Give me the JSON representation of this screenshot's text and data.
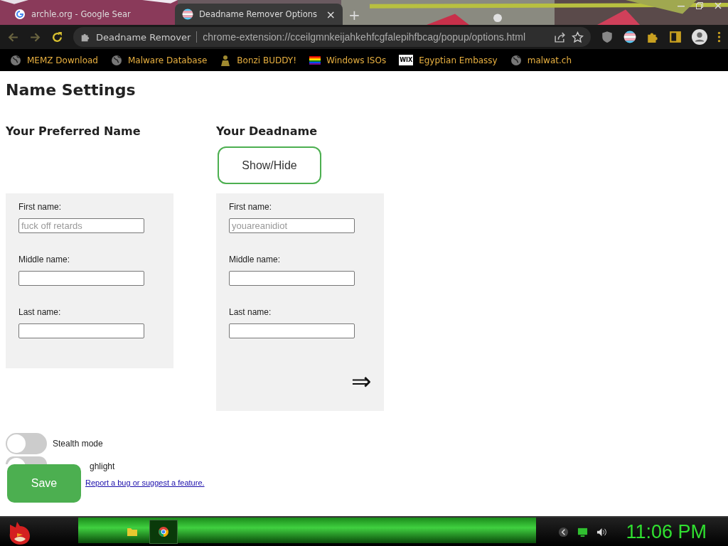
{
  "browser": {
    "tabs": [
      {
        "title": "archle.org - Google Sear",
        "selected": false,
        "kind": "google"
      },
      {
        "title": "Deadname Remover Options",
        "selected": true,
        "kind": "flag"
      }
    ],
    "tab_close": "×",
    "new_tab": "+",
    "address_bar": {
      "site": "Deadname Remover",
      "url": "chrome-extension://cceilgmnkeijahkehfcgfalepihfbcag/popup/options.html"
    },
    "bookmarks": [
      {
        "label": "MEMZ Download",
        "kind": "globe"
      },
      {
        "label": "Malware Database",
        "kind": "globe"
      },
      {
        "label": "Bonzi BUDDY!",
        "kind": "figure"
      },
      {
        "label": "Windows ISOs",
        "kind": "rainbow"
      },
      {
        "label": "Egyptian Embassy",
        "kind": "wix",
        "badge": "WIX"
      },
      {
        "label": "malwat.ch",
        "kind": "globe"
      }
    ]
  },
  "page": {
    "title": "Name Settings",
    "columns": [
      {
        "heading": "Your Preferred Name",
        "fields": [
          {
            "label": "First name:",
            "placeholder": "fuck off retards"
          },
          {
            "label": "Middle name:"
          },
          {
            "label": "Last name:"
          }
        ]
      },
      {
        "heading": "Your Deadname",
        "button": "Show/Hide",
        "arrow": "⇒",
        "fields": [
          {
            "label": "First name:",
            "placeholder": "youareanidiot"
          },
          {
            "label": "Middle name:"
          },
          {
            "label": "Last name:"
          }
        ]
      }
    ],
    "toggles": [
      {
        "label": "Stealth mode",
        "on": false
      },
      {
        "label": "ghlight",
        "on": false
      }
    ],
    "save_button": "Save",
    "link": "Report a bug or suggest a feature."
  },
  "taskbar": {
    "clock": "11:06 PM"
  }
}
